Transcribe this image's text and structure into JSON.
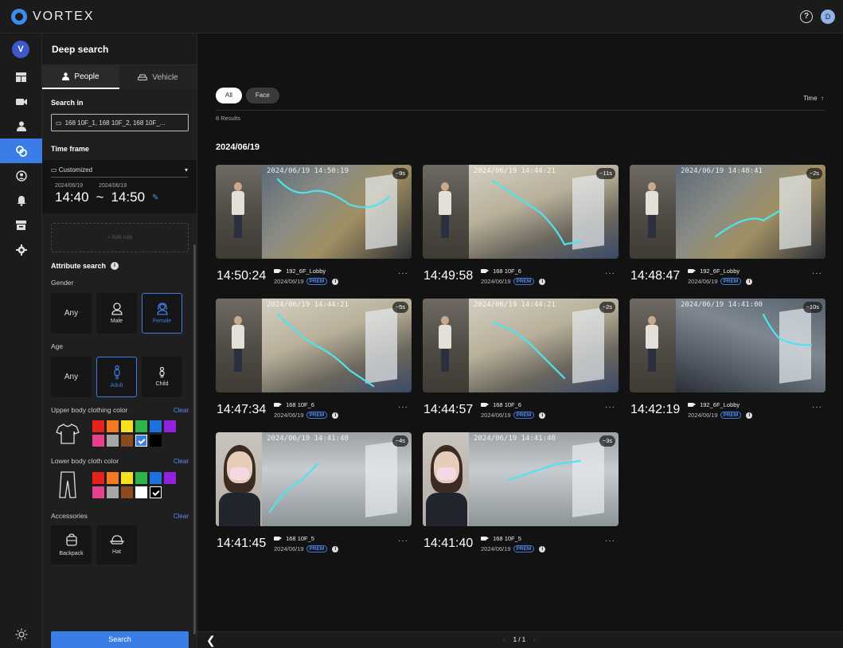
{
  "app": {
    "brand": "VORTEX",
    "user_initial": "D",
    "help": "?"
  },
  "nav": {
    "avatar": "V"
  },
  "sidebar": {
    "title": "Deep search",
    "tabs": [
      {
        "label": "People"
      },
      {
        "label": "Vehicle"
      }
    ],
    "search_in": {
      "label": "Search in",
      "value": "168 10F_1, 168 10F_2, 168 10F_..."
    },
    "time_frame": {
      "label": "Time frame",
      "mode": "Customized",
      "start_date": "2024/06/19",
      "end_date": "2024/06/19",
      "start_time": "14:40",
      "separator": "~",
      "end_time": "14:50"
    },
    "add_rule": "+ Add rule",
    "attribute_search": "Attribute search",
    "gender": {
      "label": "Gender",
      "options": [
        "Any",
        "Male",
        "Female"
      ],
      "selected": "Female"
    },
    "age": {
      "label": "Age",
      "options": [
        "Any",
        "Adult",
        "Child"
      ],
      "selected": "Adult"
    },
    "upper_color": {
      "label": "Upper body clothing color",
      "clear": "Clear",
      "colors": [
        "#e8211c",
        "#f47a1f",
        "#f5e11d",
        "#2fb34a",
        "#1f6fe0",
        "#9321e0",
        "#e8408f",
        "#a6a6a6",
        "#8b4b1e",
        "#3b7de6",
        "#000000"
      ],
      "selected_index": 9
    },
    "lower_color": {
      "label": "Lower body cloth color",
      "clear": "Clear",
      "colors": [
        "#e8211c",
        "#f47a1f",
        "#f5e11d",
        "#2fb34a",
        "#1f6fe0",
        "#9321e0",
        "#e8408f",
        "#a6a6a6",
        "#8b4b1e",
        "#ffffff",
        "#000000"
      ],
      "selected_index": 10
    },
    "accessories": {
      "label": "Accessories",
      "clear": "Clear",
      "items": [
        "Backpack",
        "Hat"
      ]
    },
    "search_button": "Search"
  },
  "main": {
    "filters": [
      "All",
      "Face"
    ],
    "active_filter": "All",
    "sort": "Time",
    "sort_arrow": "↑",
    "results": "8 Results",
    "date_header": "2024/06/19",
    "cards": [
      {
        "time": "14:50:24",
        "camera": "192_6F_Lobby",
        "date": "2024/06/19",
        "badge": "PREM",
        "duration": "9s",
        "overlay": "2024/06/19 14:50:19"
      },
      {
        "time": "14:49:58",
        "camera": "168 10F_6",
        "date": "2024/06/19",
        "badge": "PREM",
        "duration": "11s",
        "overlay": "2024/06/19 14:44:21"
      },
      {
        "time": "14:48:47",
        "camera": "192_6F_Lobby",
        "date": "2024/06/19",
        "badge": "PREM",
        "duration": "2s",
        "overlay": "2024/06/19 14:48:41"
      },
      {
        "time": "14:47:34",
        "camera": "168 10F_6",
        "date": "2024/06/19",
        "badge": "PREM",
        "duration": "5s",
        "overlay": "2024/06/19 14:44:21"
      },
      {
        "time": "14:44:57",
        "camera": "168 10F_6",
        "date": "2024/06/19",
        "badge": "PREM",
        "duration": "2s",
        "overlay": "2024/06/19 14:44:21"
      },
      {
        "time": "14:42:19",
        "camera": "192_6F_Lobby",
        "date": "2024/06/19",
        "badge": "PREM",
        "duration": "10s",
        "overlay": "2024/06/19 14:41:00"
      },
      {
        "time": "14:41:45",
        "camera": "168 10F_5",
        "date": "2024/06/19",
        "badge": "PREM",
        "duration": "4s",
        "overlay": "2024/06/19 14:41:40"
      },
      {
        "time": "14:41:40",
        "camera": "168 10F_5",
        "date": "2024/06/19",
        "badge": "PREM",
        "duration": "3s",
        "overlay": "2024/06/19 14:41:40"
      }
    ],
    "more": "···"
  },
  "pagination": {
    "prev": "‹",
    "page": "1 / 1",
    "next": "›"
  }
}
